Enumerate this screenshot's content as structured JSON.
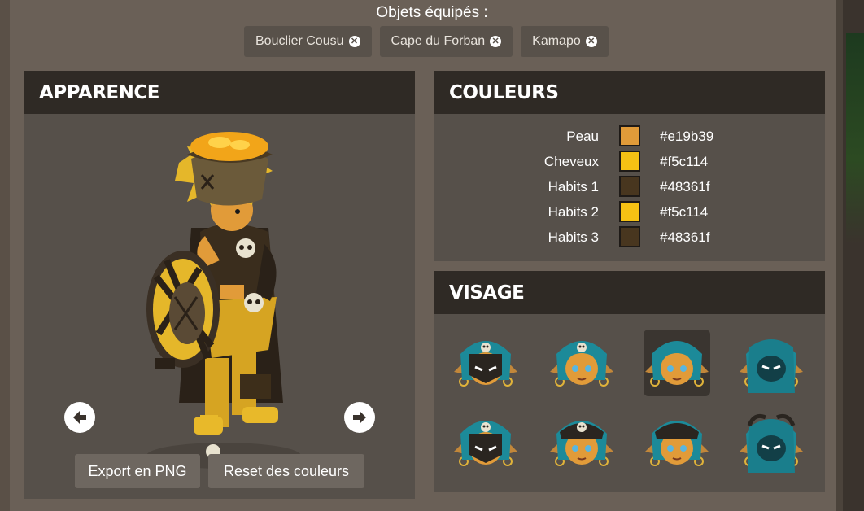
{
  "equipped": {
    "title": "Objets équipés :",
    "items": [
      {
        "label": "Bouclier Cousu"
      },
      {
        "label": "Cape du Forban"
      },
      {
        "label": "Kamapo"
      }
    ],
    "remove_symbol": "✕"
  },
  "apparence": {
    "title": "APPARENCE",
    "export_label": "Export en PNG",
    "reset_label": "Reset des couleurs",
    "prev_icon": "arrow-left-icon",
    "next_icon": "arrow-right-icon"
  },
  "couleurs": {
    "title": "COULEURS",
    "rows": [
      {
        "label": "Peau",
        "hex": "#e19b39"
      },
      {
        "label": "Cheveux",
        "hex": "#f5c114"
      },
      {
        "label": "Habits 1",
        "hex": "#48361f"
      },
      {
        "label": "Habits 2",
        "hex": "#f5c114"
      },
      {
        "label": "Habits 3",
        "hex": "#48361f"
      }
    ]
  },
  "visage": {
    "title": "VISAGE",
    "faces": [
      {
        "variant": "masked-skull"
      },
      {
        "variant": "open-skull"
      },
      {
        "variant": "open-plain",
        "selected": true
      },
      {
        "variant": "hooded"
      },
      {
        "variant": "masked-skull-wide"
      },
      {
        "variant": "open-skull-hat"
      },
      {
        "variant": "open-cap"
      },
      {
        "variant": "hooded-horns"
      }
    ]
  }
}
